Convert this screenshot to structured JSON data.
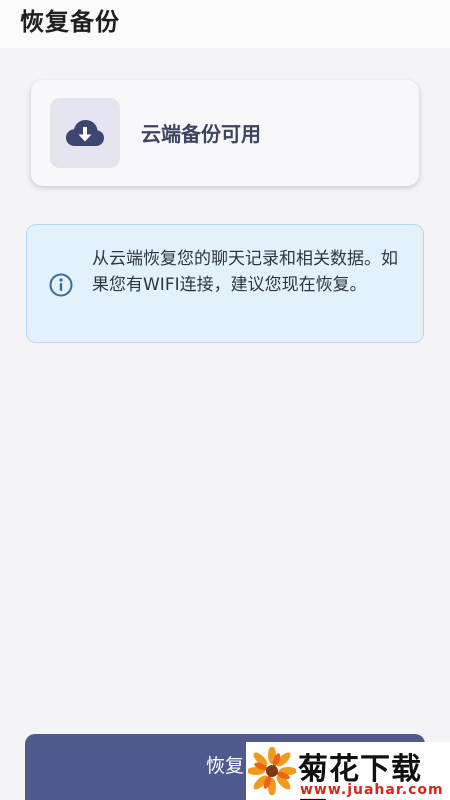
{
  "header": {
    "title": "恢复备份"
  },
  "backup_card": {
    "icon": "cloud-download-icon",
    "label": "云端备份可用"
  },
  "info": {
    "icon": "info-icon",
    "text": "从云端恢复您的聊天记录和相关数据。如果您有WIFI连接，建议您现在恢复。"
  },
  "footer": {
    "restore_label": "恢复"
  },
  "watermark": {
    "name": "菊花下载网",
    "url": "www.juahar.com"
  },
  "colors": {
    "accent": "#505b8d",
    "icon": "#3d4670",
    "info_bg": "#e3f1fc",
    "info_border": "#b6d9f2"
  }
}
